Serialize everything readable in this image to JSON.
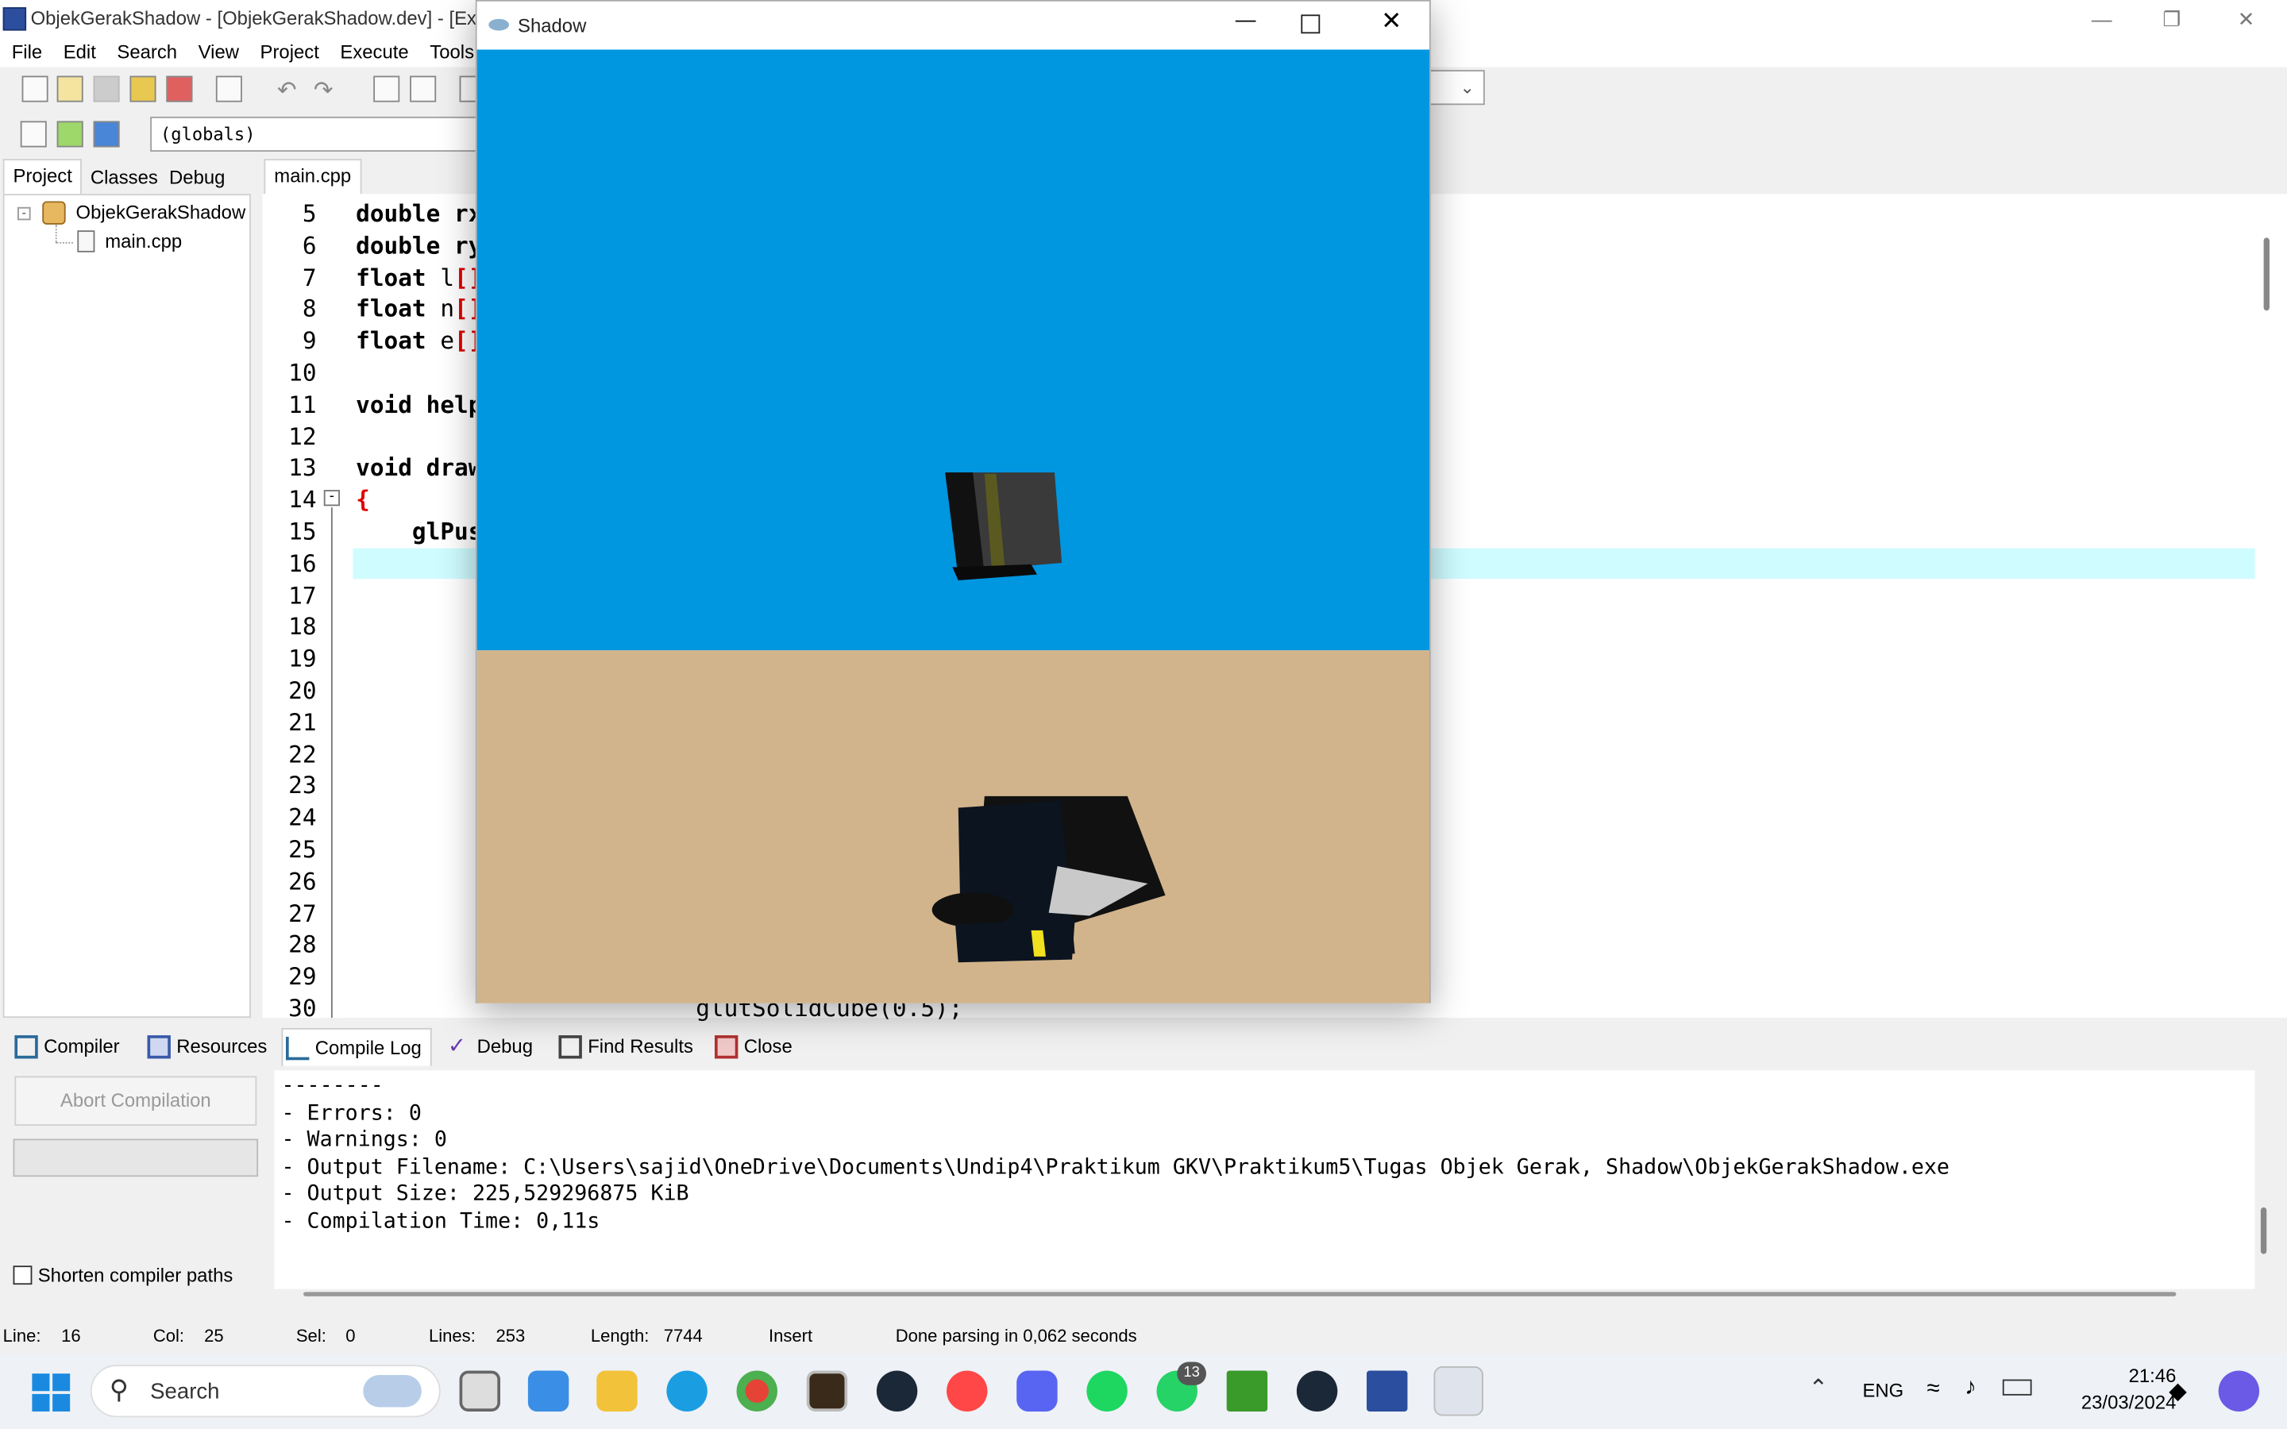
{
  "ide": {
    "title": "ObjekGerakShadow - [ObjekGerakShadow.dev] - [Exe",
    "menu": [
      "File",
      "Edit",
      "Search",
      "View",
      "Project",
      "Execute",
      "Tools"
    ],
    "globals_combo": "(globals)",
    "left_tabs": [
      "Project",
      "Classes",
      "Debug"
    ],
    "project_tree": {
      "root": "ObjekGerakShadow",
      "file": "main.cpp"
    },
    "editor_tab": "main.cpp",
    "line_numbers": [
      "5",
      "6",
      "7",
      "8",
      "9",
      "10",
      "11",
      "12",
      "13",
      "14",
      "15",
      "16",
      "17",
      "18",
      "19",
      "20",
      "21",
      "22",
      "23",
      "24",
      "25",
      "26",
      "27",
      "28",
      "29",
      "30"
    ],
    "code_lines": [
      {
        "ln": "5",
        "text": "double rx"
      },
      {
        "ln": "6",
        "text": "double ry"
      },
      {
        "ln": "7",
        "kw": "float ",
        "id": "l",
        "br": "[]"
      },
      {
        "ln": "8",
        "kw": "float ",
        "id": "n",
        "br": "[]"
      },
      {
        "ln": "9",
        "kw": "float ",
        "id": "e",
        "br": "[]"
      },
      {
        "ln": "11",
        "text": "void help"
      },
      {
        "ln": "13",
        "text": "void draw"
      },
      {
        "ln": "14",
        "brace": "{"
      },
      {
        "ln": "15",
        "text": "    glPus"
      },
      {
        "ln": "30",
        "text": "        glutSolidCube(0.5);"
      }
    ],
    "bottom_tabs": [
      "Compiler",
      "Resources",
      "Compile Log",
      "Debug",
      "Find Results",
      "Close"
    ],
    "abort_button": "Abort Compilation",
    "shorten_paths": "Shorten compiler paths",
    "log_lines": [
      "--------",
      "- Errors: 0",
      "- Warnings: 0",
      "- Output Filename: C:\\Users\\sajid\\OneDrive\\Documents\\Undip4\\Praktikum GKV\\Praktikum5\\Tugas Objek Gerak, Shadow\\ObjekGerakShadow.exe",
      "- Output Size: 225,529296875 KiB",
      "- Compilation Time: 0,11s"
    ],
    "status": {
      "line_label": "Line:",
      "line": "16",
      "col_label": "Col:",
      "col": "25",
      "sel_label": "Sel:",
      "sel": "0",
      "lines_label": "Lines:",
      "lines": "253",
      "length_label": "Length:",
      "length": "7744",
      "mode": "Insert",
      "message": "Done parsing in 0,062 seconds"
    }
  },
  "shadow_window": {
    "title": "Shadow",
    "sky_color": "#0096e0",
    "ground_color": "#d2b48c"
  },
  "taskbar": {
    "search": "Search",
    "lang": "ENG",
    "time": "21:46",
    "date": "23/03/2024",
    "whatsapp_badge": "13"
  }
}
